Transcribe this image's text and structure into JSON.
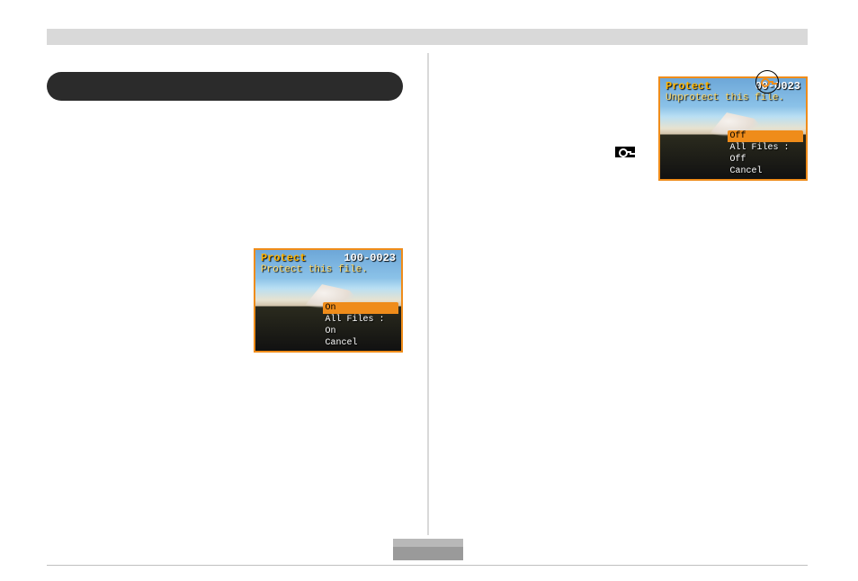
{
  "topbar": {
    "title": ""
  },
  "pill": {
    "label": ""
  },
  "lcd_left": {
    "header": "Protect",
    "filenum": "100-0023",
    "subtitle": "Protect this file.",
    "menu": {
      "highlight": "On",
      "rows": [
        "All Files : On",
        "Cancel"
      ]
    }
  },
  "lcd_right": {
    "header": "Protect",
    "filenum": "00-0023",
    "subtitle": "Unprotect this file.",
    "key_icon": "key-icon",
    "menu": {
      "highlight": "Off",
      "rows": [
        "All Files : Off",
        "Cancel"
      ]
    }
  },
  "inline_key": {
    "icon": "key-icon"
  },
  "footer": {
    "page": ""
  }
}
